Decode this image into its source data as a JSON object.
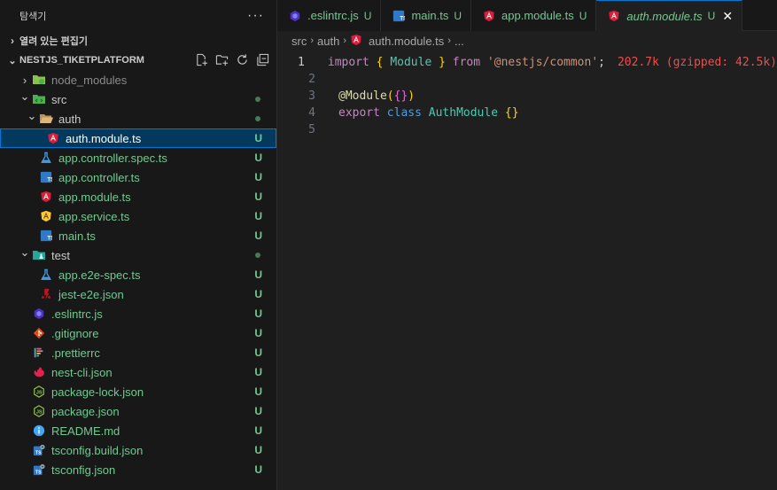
{
  "sidebar": {
    "title": "탐색기",
    "more": "···",
    "open_editors": "열려 있는 편집기",
    "project": "NESTJS_TIKETPLATFORM",
    "items": [
      {
        "label": "node_modules",
        "depth": 0,
        "kind": "folder",
        "icon": "node-folder-icon",
        "status": ""
      },
      {
        "label": "src",
        "depth": 0,
        "kind": "folder-open",
        "icon": "src-folder-icon",
        "status": "dot"
      },
      {
        "label": "auth",
        "depth": 1,
        "kind": "folder-open",
        "icon": "folder-open-icon",
        "status": "dot"
      },
      {
        "label": "auth.module.ts",
        "depth": 2,
        "kind": "file",
        "icon": "angular-icon",
        "status": "U",
        "selected": true
      },
      {
        "label": "app.controller.spec.ts",
        "depth": 1,
        "kind": "file",
        "icon": "flask-icon",
        "status": "U"
      },
      {
        "label": "app.controller.ts",
        "depth": 1,
        "kind": "file",
        "icon": "ts-icon",
        "status": "U"
      },
      {
        "label": "app.module.ts",
        "depth": 1,
        "kind": "file",
        "icon": "angular-icon",
        "status": "U"
      },
      {
        "label": "app.service.ts",
        "depth": 1,
        "kind": "file",
        "icon": "angular-service-icon",
        "status": "U"
      },
      {
        "label": "main.ts",
        "depth": 1,
        "kind": "file",
        "icon": "ts-icon",
        "status": "U"
      },
      {
        "label": "test",
        "depth": 0,
        "kind": "folder-open",
        "icon": "test-folder-icon",
        "status": "dot"
      },
      {
        "label": "app.e2e-spec.ts",
        "depth": 1,
        "kind": "file",
        "icon": "flask-icon",
        "status": "U"
      },
      {
        "label": "jest-e2e.json",
        "depth": 1,
        "kind": "file",
        "icon": "jest-icon",
        "status": "U"
      },
      {
        "label": ".eslintrc.js",
        "depth": 0,
        "kind": "file",
        "icon": "eslint-icon",
        "status": "U"
      },
      {
        "label": ".gitignore",
        "depth": 0,
        "kind": "file",
        "icon": "git-icon",
        "status": "U"
      },
      {
        "label": ".prettierrc",
        "depth": 0,
        "kind": "file",
        "icon": "prettier-icon",
        "status": "U"
      },
      {
        "label": "nest-cli.json",
        "depth": 0,
        "kind": "file",
        "icon": "nest-icon",
        "status": "U"
      },
      {
        "label": "package-lock.json",
        "depth": 0,
        "kind": "file",
        "icon": "node-icon",
        "status": "U"
      },
      {
        "label": "package.json",
        "depth": 0,
        "kind": "file",
        "icon": "node-icon",
        "status": "U"
      },
      {
        "label": "README.md",
        "depth": 0,
        "kind": "file",
        "icon": "info-icon",
        "status": "U"
      },
      {
        "label": "tsconfig.build.json",
        "depth": 0,
        "kind": "file",
        "icon": "tsconfig-icon",
        "status": "U"
      },
      {
        "label": "tsconfig.json",
        "depth": 0,
        "kind": "file",
        "icon": "tsconfig-icon",
        "status": "U"
      }
    ]
  },
  "tabs": [
    {
      "label": ".eslintrc.js",
      "icon": "eslint-icon",
      "status": "U"
    },
    {
      "label": "main.ts",
      "icon": "ts-icon",
      "status": "U"
    },
    {
      "label": "app.module.ts",
      "icon": "angular-icon",
      "status": "U"
    },
    {
      "label": "auth.module.ts",
      "icon": "angular-icon",
      "status": "U",
      "active": true
    }
  ],
  "breadcrumb": [
    "src",
    "auth",
    "auth.module.ts",
    "..."
  ],
  "code": {
    "line_numbers": [
      "1",
      "2",
      "3",
      "4",
      "5"
    ],
    "import_kw": "import",
    "open_brace": "{",
    "module_name": "Module",
    "close_brace": "}",
    "from_kw": "from",
    "module_path": "'@nestjs/common'",
    "semicolon": ";",
    "import_cost": "202.7k (gzipped: 42.5k)",
    "decorator": "@Module",
    "decorator_args_open": "(",
    "decorator_obj": "{}",
    "decorator_args_close": ")",
    "export_kw": "export",
    "class_kw": "class",
    "class_name": "AuthModule",
    "class_body": "{}"
  },
  "colors": {
    "untracked": "#73c991",
    "selection": "#04395e",
    "accent": "#0078d4"
  }
}
